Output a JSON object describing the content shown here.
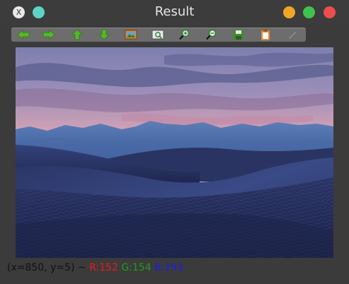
{
  "window": {
    "title": "Result"
  },
  "titlebar": {
    "close_left_glyph": "X"
  },
  "toolbar": {
    "buttons": [
      {
        "name": "arrow-left-icon",
        "color": "#55b82a"
      },
      {
        "name": "arrow-right-icon",
        "color": "#55b82a"
      },
      {
        "name": "arrow-up-icon",
        "color": "#55b82a"
      },
      {
        "name": "arrow-down-icon",
        "color": "#55b82a"
      },
      {
        "name": "image-icon",
        "color": "#e9862f"
      },
      {
        "name": "zoom-fit-icon",
        "color": "#e8e8e8"
      },
      {
        "name": "zoom-in-icon",
        "color": "#4aa43a"
      },
      {
        "name": "zoom-out-icon",
        "color": "#4aa43a"
      },
      {
        "name": "save-icon",
        "color": "#3d8c2c"
      },
      {
        "name": "clipboard-icon",
        "color": "#e9862f"
      },
      {
        "name": "pen-icon",
        "color": "#8a8a8a"
      }
    ]
  },
  "status": {
    "coords": "(x=850, y=5) ~ ",
    "r": "R:152",
    "g": "G:154",
    "b": "B:193"
  },
  "colors": {
    "sky_top": "#7b7ea8",
    "sky_mid": "#e0a8b5",
    "dune_dark": "#1f2750",
    "mountain": "#4a6ea8"
  }
}
